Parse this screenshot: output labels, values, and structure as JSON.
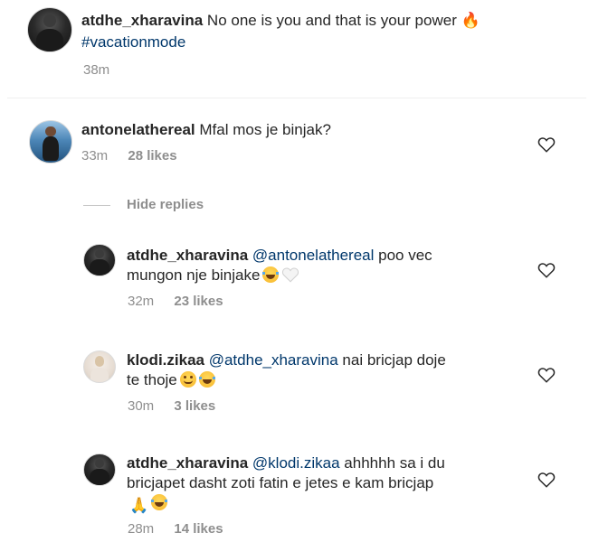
{
  "post": {
    "username": "atdhe_xharavina",
    "caption": "No one is you and that is your power",
    "caption_emoji": "🔥",
    "hashtag": "#vacationmode",
    "time": "38m"
  },
  "comments": [
    {
      "username": "antonelathereal",
      "text": "Mfal mos je binjak?",
      "time": "33m",
      "likes": "28 likes"
    }
  ],
  "hide_replies_label": "Hide replies",
  "replies": [
    {
      "username": "atdhe_xharavina",
      "mention": "@antonelathereal",
      "text_line1": "poo vec",
      "text_line2": "mungon nje binjake",
      "time": "32m",
      "likes": "23 likes"
    },
    {
      "username": "klodi.zikaa",
      "mention": "@atdhe_xharavina",
      "text_line1": "nai bricjap doje",
      "text_line2": "te thoje",
      "time": "30m",
      "likes": "3 likes"
    },
    {
      "username": "atdhe_xharavina",
      "mention": "@klodi.zikaa",
      "text_line1": "ahhhhh sa i du",
      "text_line2": "bricjapet dasht zoti fatin e jetes e kam bricjap",
      "time": "28m",
      "likes": "14 likes"
    }
  ],
  "icons": {
    "like": "heart-outline-icon"
  }
}
